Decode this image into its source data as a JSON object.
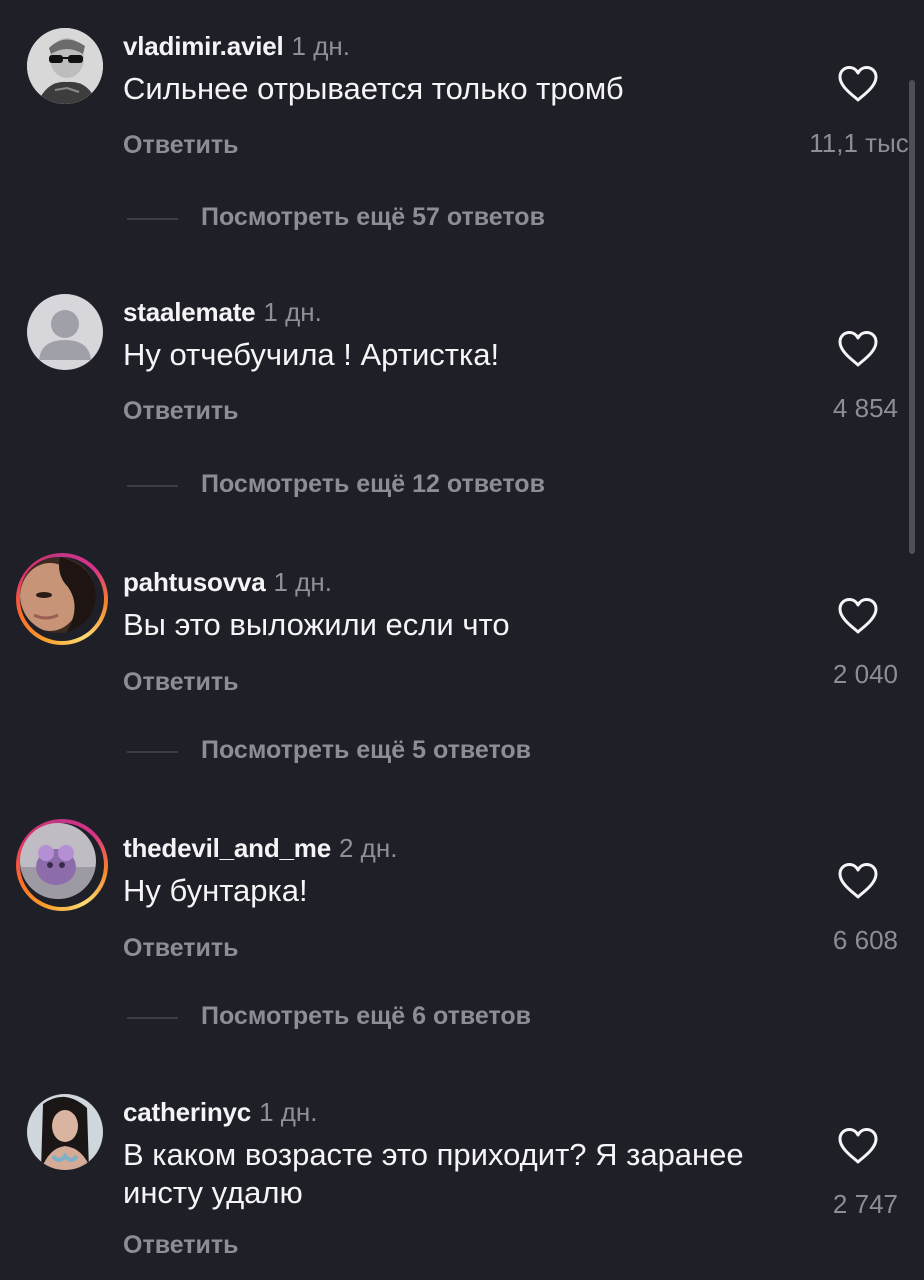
{
  "comments": [
    {
      "username": "vladimir.aviel",
      "time": "1 дн.",
      "text": "Сильнее отрывается только тромб",
      "reply": "Ответить",
      "likes": "11,1 тыс.",
      "more_replies": "Посмотреть ещё 57 ответов"
    },
    {
      "username": "staalemate",
      "time": "1 дн.",
      "text": "Ну отчебучила ! Артистка!",
      "reply": "Ответить",
      "likes": "4 854",
      "more_replies": "Посмотреть ещё 12 ответов"
    },
    {
      "username": "pahtusovva",
      "time": "1 дн.",
      "text": "Вы это выложили если что",
      "reply": "Ответить",
      "likes": "2 040",
      "more_replies": "Посмотреть ещё 5 ответов"
    },
    {
      "username": "thedevil_and_me",
      "time": "2 дн.",
      "text": "Ну бунтарка!",
      "reply": "Ответить",
      "likes": "6 608",
      "more_replies": "Посмотреть ещё 6 ответов"
    },
    {
      "username": "catherinyc",
      "time": "1 дн.",
      "text": "В каком возрасте это приходит? Я заранее инсту удалю",
      "reply": "Ответить",
      "likes": "2 747"
    }
  ],
  "icons": {
    "like": "heart-outline-icon"
  },
  "colors": {
    "background": "#1f2027",
    "primary_text": "#f5f5f7",
    "secondary_text": "#8c8d96",
    "story_ring_start": "#f9a12e",
    "story_ring_end": "#c13584"
  }
}
